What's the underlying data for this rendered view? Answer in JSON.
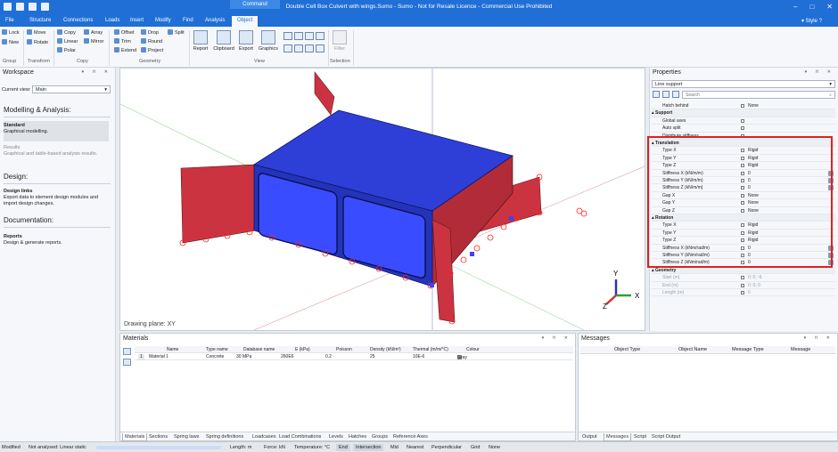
{
  "title": "Double Cell Box Culvert with wings.Sumo - Sumo - Not for Resale Licence - Commercial Use Prohibited",
  "command_badge": "Command",
  "menu": [
    "File",
    "Structure",
    "Connections",
    "Loads",
    "Insert",
    "Modify",
    "Find",
    "Analysis",
    "Object"
  ],
  "menu_active": "Object",
  "style_label": "Style",
  "ribbon": {
    "group_small": [
      "Lock",
      "New"
    ],
    "transform_small": [
      "Move",
      "Rotate"
    ],
    "copy_small": [
      "Copy",
      "Linear",
      "Polar",
      "Array",
      "Mirror"
    ],
    "geometry_small": [
      "Offset",
      "Trim",
      "Extend",
      "Drop",
      "Round",
      "Project",
      "Split"
    ],
    "view_big": [
      "Report",
      "Clipboard",
      "Export",
      "Graphics"
    ],
    "selection_big": [
      "Filter"
    ],
    "groups": [
      "Group",
      "Transform",
      "Copy",
      "Geometry",
      "View",
      "Selection"
    ]
  },
  "workspace": {
    "title": "Workspace",
    "current_view_label": "Current view:",
    "current_view_value": "Main",
    "modelling_heading": "Modelling & Analysis:",
    "standard_title": "Standard",
    "standard_desc": "Graphical modelling.",
    "results_title": "Results",
    "results_desc": "Graphical and table-based analysis results.",
    "design_heading": "Design:",
    "design_links_title": "Design links",
    "design_links_desc": "Export data to element design modules and import design changes.",
    "documentation_heading": "Documentation:",
    "reports_title": "Reports",
    "reports_desc": "Design & generate reports."
  },
  "viewport": {
    "drawing_plane": "Drawing plane: XY",
    "axis_x": "X",
    "axis_y": "Y",
    "axis_z": "Z"
  },
  "properties": {
    "title": "Properties",
    "selected": "Line support",
    "search_placeholder": "Search",
    "rows": [
      {
        "type": "row",
        "name": "Hatch behind",
        "value": "None"
      },
      {
        "type": "cat",
        "name": "Support"
      },
      {
        "type": "row",
        "name": "Global axes",
        "value": ""
      },
      {
        "type": "row",
        "name": "Auto split",
        "value": ""
      },
      {
        "type": "row",
        "name": "Distribute stiffness",
        "value": ""
      },
      {
        "type": "cat",
        "name": "Translation"
      },
      {
        "type": "row",
        "name": "Type X",
        "value": "Rigid"
      },
      {
        "type": "row",
        "name": "Type Y",
        "value": "Rigid"
      },
      {
        "type": "row",
        "name": "Type Z",
        "value": "Rigid"
      },
      {
        "type": "row",
        "name": "Stiffness X (kN/m/m)",
        "value": "0",
        "edit": true
      },
      {
        "type": "row",
        "name": "Stiffness Y (kN/m/m)",
        "value": "0",
        "edit": true
      },
      {
        "type": "row",
        "name": "Stiffness Z (kN/m/m)",
        "value": "0",
        "edit": true
      },
      {
        "type": "row",
        "name": "Gap X",
        "value": "None"
      },
      {
        "type": "row",
        "name": "Gap Y",
        "value": "None"
      },
      {
        "type": "row",
        "name": "Gap Z",
        "value": "None"
      },
      {
        "type": "cat",
        "name": "Rotation"
      },
      {
        "type": "row",
        "name": "Type X",
        "value": "Rigid"
      },
      {
        "type": "row",
        "name": "Type Y",
        "value": "Rigid"
      },
      {
        "type": "row",
        "name": "Type Z",
        "value": "Rigid"
      },
      {
        "type": "row",
        "name": "Stiffness X (kNm/rad/m)",
        "value": "0",
        "edit": true
      },
      {
        "type": "row",
        "name": "Stiffness Y (kNm/rad/m)",
        "value": "0",
        "edit": true
      },
      {
        "type": "row",
        "name": "Stiffness Z (kNm/rad/m)",
        "value": "0",
        "edit": true
      },
      {
        "type": "cat",
        "name": "Geometry"
      },
      {
        "type": "row",
        "name": "Start (m)",
        "value": "0; 0; -6",
        "dim": true
      },
      {
        "type": "row",
        "name": "End (m)",
        "value": "0; 0; 0",
        "dim": true
      },
      {
        "type": "row",
        "name": "Length (m)",
        "value": "6",
        "dim": true
      }
    ]
  },
  "materials": {
    "title": "Materials",
    "headers": [
      "Name",
      "Type name",
      "Database name",
      "E (kPa)",
      "Poisson",
      "Density (kN/m³)",
      "Thermal (m/m/°C)",
      "Colour"
    ],
    "rows": [
      [
        "Material 1",
        "Concrete",
        "30 MPa",
        "260E6",
        "0.2",
        "25",
        "10E-6",
        "Gray"
      ]
    ],
    "row_index": "1",
    "tabs": [
      "Materials",
      "Sections",
      "Spring laws",
      "Spring definitions",
      "Loadcases",
      "Load Combinations",
      "Levels",
      "Hatches",
      "Groups",
      "Reference Axes"
    ],
    "active_tab": "Materials"
  },
  "messages": {
    "title": "Messages",
    "headers": [
      "Object Type",
      "Object Name",
      "Message Type",
      "Message"
    ],
    "tabs": [
      "Output",
      "Messages",
      "Script",
      "Script Output"
    ],
    "active_tab": "Messages"
  },
  "status": {
    "modified": "Modified",
    "analysis": "Not analysed: Linear static",
    "length": "Length: m",
    "force": "Force: kN",
    "temperature": "Temperature: °C",
    "snaps": [
      "End",
      "Intersection",
      "Mid",
      "Nearest",
      "Perpendicular",
      "Grid",
      "None"
    ],
    "snaps_active": [
      "End",
      "Intersection"
    ]
  },
  "colors": {
    "accent": "#1f6fd6",
    "highlight": "#e02020",
    "slab": "#2e3fd8",
    "wall": "#cc3340"
  }
}
